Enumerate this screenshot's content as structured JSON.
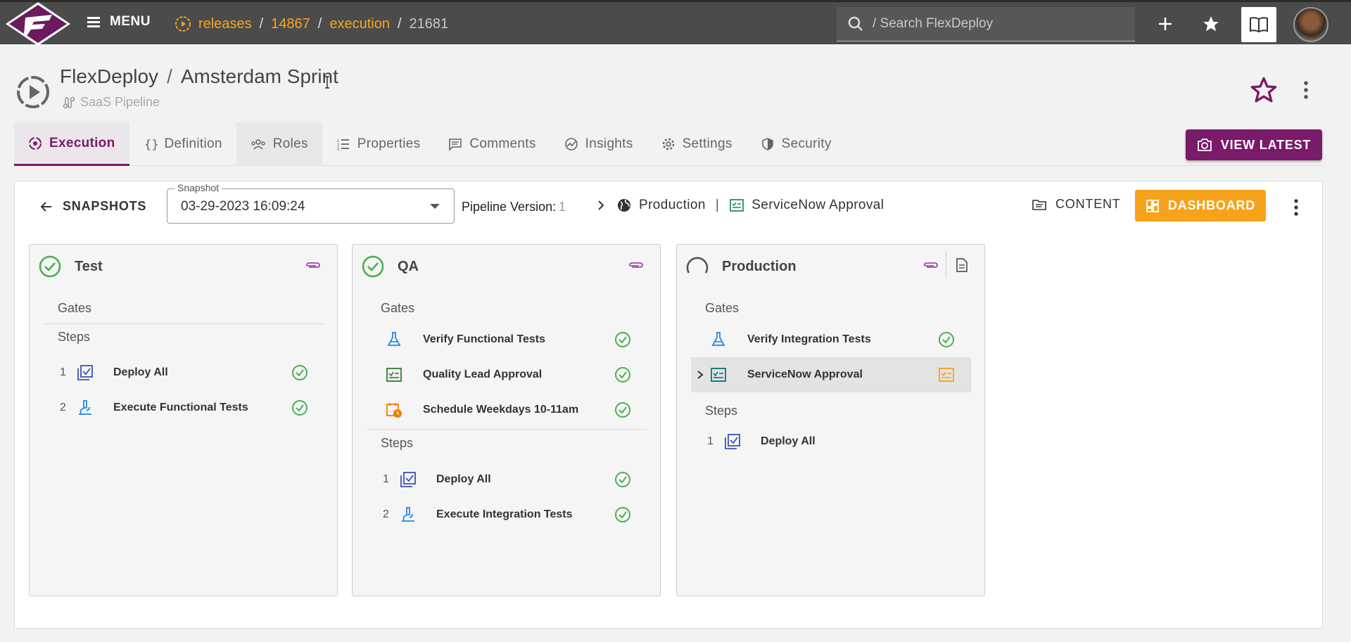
{
  "nav": {
    "menu_label": "MENU",
    "breadcrumbs": [
      "releases",
      "14867",
      "execution",
      "21681"
    ],
    "search_placeholder": "/ Search FlexDeploy"
  },
  "header": {
    "project": "FlexDeploy",
    "release": "Amsterdam Sprint",
    "pipeline": "SaaS Pipeline"
  },
  "tabs": [
    "Execution",
    "Definition",
    "Roles",
    "Properties",
    "Comments",
    "Insights",
    "Settings",
    "Security"
  ],
  "view_latest_label": "VIEW LATEST",
  "toolbar": {
    "snapshots_label": "SNAPSHOTS",
    "snapshot_field_label": "Snapshot",
    "snapshot_value": "03-29-2023 16:09:24",
    "pipeline_version_label": "Pipeline Version:",
    "pipeline_version_value": "1",
    "current_env": "Production",
    "current_gate": "ServiceNow Approval",
    "content_label": "CONTENT",
    "dashboard_label": "DASHBOARD"
  },
  "stages": [
    {
      "name": "Test",
      "status": "success",
      "gates_label": "Gates",
      "gates": [],
      "steps_label": "Steps",
      "steps": [
        {
          "index": "1",
          "name": "Deploy All",
          "status": "success"
        },
        {
          "index": "2",
          "name": "Execute Functional Tests",
          "status": "success"
        }
      ]
    },
    {
      "name": "QA",
      "status": "success",
      "gates_label": "Gates",
      "gates": [
        {
          "name": "Verify Functional Tests",
          "icon": "flask-icon",
          "status": "success"
        },
        {
          "name": "Quality Lead Approval",
          "icon": "approval-icon",
          "status": "success"
        },
        {
          "name": "Schedule Weekdays 10-11am",
          "icon": "schedule-icon",
          "status": "success"
        }
      ],
      "steps_label": "Steps",
      "steps": [
        {
          "index": "1",
          "name": "Deploy All",
          "status": "success"
        },
        {
          "index": "2",
          "name": "Execute Integration Tests",
          "status": "success"
        }
      ]
    },
    {
      "name": "Production",
      "status": "running",
      "gates_label": "Gates",
      "gates": [
        {
          "name": "Verify Integration Tests",
          "icon": "flask-icon",
          "status": "success"
        },
        {
          "name": "ServiceNow Approval",
          "icon": "approval-icon",
          "status": "pending"
        }
      ],
      "steps_label": "Steps",
      "steps": [
        {
          "index": "1",
          "name": "Deploy All",
          "status": "not-started"
        }
      ]
    }
  ],
  "colors": {
    "topbar": "#4b4b4b",
    "accent_purple": "#7a1a6a",
    "breadcrumb_orange": "#f5a623",
    "dashboard_orange": "#f7a21b",
    "success_green": "#4caf50"
  }
}
